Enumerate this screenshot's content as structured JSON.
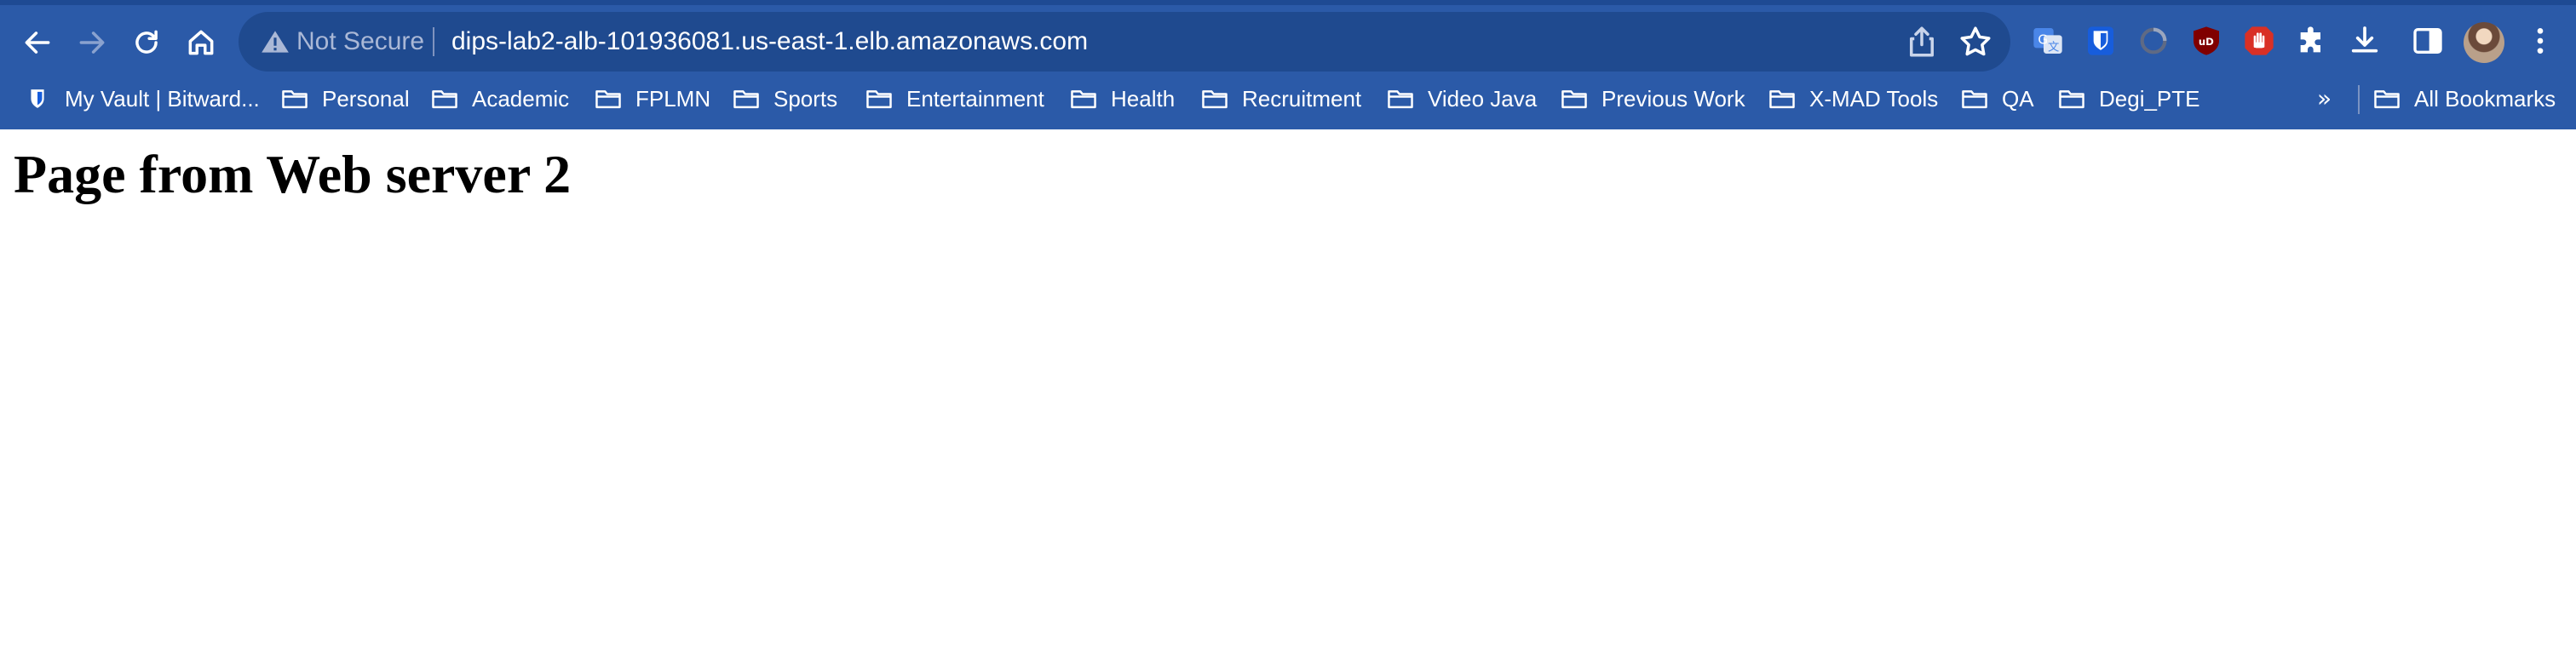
{
  "browser": {
    "toolbar": {
      "back_icon": "arrow-left-icon",
      "forward_icon": "arrow-right-icon",
      "reload_icon": "reload-icon",
      "home_icon": "home-icon"
    },
    "address_bar": {
      "security_icon": "warning-triangle-icon",
      "security_label": "Not Secure",
      "url": "dips-lab2-alb-101936081.us-east-1.elb.amazonaws.com",
      "share_icon": "share-icon",
      "bookmark_icon": "star-icon"
    },
    "extensions": [
      {
        "name": "google-translate-icon"
      },
      {
        "name": "bitwarden-shield-icon"
      },
      {
        "name": "extension-circle-icon"
      },
      {
        "name": "ublock-origin-icon"
      },
      {
        "name": "stop-hand-icon"
      },
      {
        "name": "puzzle-icon"
      },
      {
        "name": "download-icon"
      },
      {
        "name": "side-panel-icon"
      },
      {
        "name": "profile-avatar"
      },
      {
        "name": "kebab-menu-icon"
      }
    ],
    "bookmarks": [
      {
        "label": "My Vault | Bitward...",
        "icon": "bitwarden-shield-icon"
      },
      {
        "label": "Personal",
        "icon": "folder-icon"
      },
      {
        "label": "Academic",
        "icon": "folder-icon"
      },
      {
        "label": "FPLMN",
        "icon": "folder-icon"
      },
      {
        "label": "Sports",
        "icon": "folder-icon"
      },
      {
        "label": "Entertainment",
        "icon": "folder-icon"
      },
      {
        "label": "Health",
        "icon": "folder-icon"
      },
      {
        "label": "Recruitment",
        "icon": "folder-icon"
      },
      {
        "label": "Video Java",
        "icon": "folder-icon"
      },
      {
        "label": "Previous Work",
        "icon": "folder-icon"
      },
      {
        "label": "X-MAD Tools",
        "icon": "folder-icon"
      },
      {
        "label": "QA",
        "icon": "folder-icon"
      },
      {
        "label": "Degi_PTE",
        "icon": "folder-icon"
      }
    ],
    "more_bookmarks": "»",
    "all_bookmarks": {
      "label": "All Bookmarks",
      "icon": "folder-icon"
    },
    "colors": {
      "chrome": "#2b5aa8",
      "omnibox": "#1f4a8f",
      "text": "#ffffff"
    }
  },
  "page": {
    "heading": "Page from Web server 2"
  }
}
